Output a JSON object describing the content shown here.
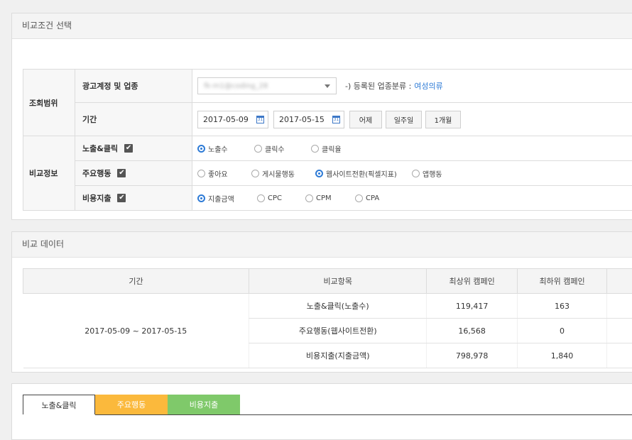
{
  "compare_section": {
    "title": "비교조건 선택",
    "scope": {
      "category": "조회범위",
      "account_label": "광고계정 및 업종",
      "account_value": "fk-m1@coding_28",
      "business_note": "-) 등록된 업종분류 :",
      "business_value": "여성의류",
      "period_label": "기간",
      "start_date": "2017-05-09",
      "end_date": "2017-05-15",
      "calendar_glyph": "31",
      "quick_buttons": [
        "어제",
        "일주일",
        "1개월"
      ]
    },
    "info": {
      "category": "비교정보",
      "rows": [
        {
          "label": "노출&클릭",
          "checked": "✔",
          "options": [
            "노출수",
            "클릭수",
            "클릭율"
          ],
          "selected_index": 0
        },
        {
          "label": "주요행동",
          "checked": "✔",
          "options": [
            "좋아요",
            "게시물행동",
            "웹사이트전환(픽셀지표)",
            "앱행동"
          ],
          "selected_index": 2
        },
        {
          "label": "비용지출",
          "checked": "✔",
          "options": [
            "지출금액",
            "CPC",
            "CPM",
            "CPA"
          ],
          "selected_index": 0
        }
      ]
    }
  },
  "data_section": {
    "title": "비교 데이터",
    "headers": [
      "기간",
      "비교항목",
      "최상위 캠페인",
      "최하위 캠페인"
    ],
    "period": "2017-05-09 ~ 2017-05-15",
    "rows": [
      {
        "item": "노출&클릭(노출수)",
        "top": "119,417",
        "bottom": "163"
      },
      {
        "item": "주요행동(웹사이트전환)",
        "top": "16,568",
        "bottom": "0"
      },
      {
        "item": "비용지출(지출금액)",
        "top": "798,978",
        "bottom": "1,840"
      }
    ]
  },
  "tabs": {
    "items": [
      "노출&클릭",
      "주요행동",
      "비용지출"
    ],
    "active_index": 0,
    "colors": [
      "#ffffff",
      "#fbb93c",
      "#7fc96a"
    ]
  }
}
